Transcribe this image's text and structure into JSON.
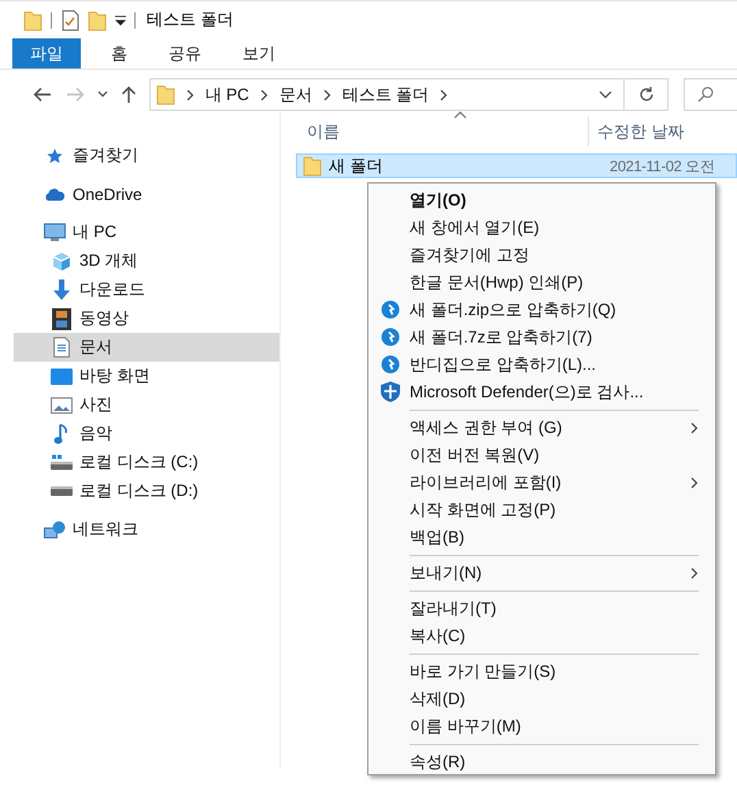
{
  "title_bar": {
    "title": "테스트 폴더"
  },
  "ribbon": {
    "tabs": [
      {
        "label": "파일",
        "kind": "file_menu",
        "selected": false
      },
      {
        "label": "홈",
        "kind": "tab",
        "selected": false
      },
      {
        "label": "공유",
        "kind": "tab",
        "selected": false
      },
      {
        "label": "보기",
        "kind": "tab",
        "selected": false
      }
    ]
  },
  "nav_buttons": [
    {
      "kind": "back",
      "disabled": false
    },
    {
      "kind": "forward",
      "disabled": true
    },
    {
      "kind": "recent",
      "disabled": false
    },
    {
      "kind": "up",
      "disabled": false
    }
  ],
  "address_bar": {
    "path": [
      "내 PC",
      "문서",
      "테스트 폴더"
    ]
  },
  "navigation": {
    "items": [
      {
        "label": "즐겨찾기",
        "selected": false
      },
      {
        "label": "OneDrive",
        "selected": false
      },
      {
        "label": "내 PC",
        "selected": false,
        "children": [
          {
            "label": "3D 개체",
            "selected": false
          },
          {
            "label": "다운로드",
            "selected": false
          },
          {
            "label": "동영상",
            "selected": false
          },
          {
            "label": "문서",
            "selected": true
          },
          {
            "label": "바탕 화면",
            "selected": false
          },
          {
            "label": "사진",
            "selected": false
          },
          {
            "label": "음악",
            "selected": false
          },
          {
            "label": "로컬 디스크 (C:)",
            "selected": false
          },
          {
            "label": "로컬 디스크 (D:)",
            "selected": false
          }
        ]
      },
      {
        "label": "네트워크",
        "selected": false
      }
    ]
  },
  "file_list": {
    "columns": [
      "이름",
      "수정한 날짜"
    ],
    "rows": [
      {
        "name": "새 폴더",
        "modified": "2021-11-02 오전",
        "selected": true
      }
    ]
  },
  "context_menu": {
    "items": [
      {
        "kind": "item",
        "label": "열기(O)",
        "default": true,
        "submenu": false
      },
      {
        "kind": "item",
        "label": "새 창에서 열기(E)",
        "default": false,
        "submenu": false
      },
      {
        "kind": "item",
        "label": "즐겨찾기에 고정",
        "default": false,
        "submenu": false
      },
      {
        "kind": "item",
        "label": "한글 문서(Hwp) 인쇄(P)",
        "default": false,
        "submenu": false
      },
      {
        "kind": "item",
        "label": "새 폴더.zip으로 압축하기(Q)",
        "default": false,
        "submenu": false
      },
      {
        "kind": "item",
        "label": "새 폴더.7z로 압축하기(7)",
        "default": false,
        "submenu": false
      },
      {
        "kind": "item",
        "label": "반디집으로 압축하기(L)...",
        "default": false,
        "submenu": false
      },
      {
        "kind": "item",
        "label": "Microsoft Defender(으)로 검사...",
        "default": false,
        "submenu": false
      },
      {
        "kind": "separator"
      },
      {
        "kind": "item",
        "label": "액세스 권한 부여 (G)",
        "default": false,
        "submenu": true
      },
      {
        "kind": "item",
        "label": "이전 버전 복원(V)",
        "default": false,
        "submenu": false
      },
      {
        "kind": "item",
        "label": "라이브러리에 포함(I)",
        "default": false,
        "submenu": true
      },
      {
        "kind": "item",
        "label": "시작 화면에 고정(P)",
        "default": false,
        "submenu": false
      },
      {
        "kind": "item",
        "label": "백업(B)",
        "default": false,
        "submenu": false
      },
      {
        "kind": "separator"
      },
      {
        "kind": "item",
        "label": "보내기(N)",
        "default": false,
        "submenu": true
      },
      {
        "kind": "separator"
      },
      {
        "kind": "item",
        "label": "잘라내기(T)",
        "default": false,
        "submenu": false
      },
      {
        "kind": "item",
        "label": "복사(C)",
        "default": false,
        "submenu": false
      },
      {
        "kind": "separator"
      },
      {
        "kind": "item",
        "label": "바로 가기 만들기(S)",
        "default": false,
        "submenu": false
      },
      {
        "kind": "item",
        "label": "삭제(D)",
        "default": false,
        "submenu": false
      },
      {
        "kind": "item",
        "label": "이름 바꾸기(M)",
        "default": false,
        "submenu": false
      },
      {
        "kind": "separator"
      },
      {
        "kind": "item",
        "label": "속성(R)",
        "default": false,
        "submenu": false
      }
    ]
  }
}
